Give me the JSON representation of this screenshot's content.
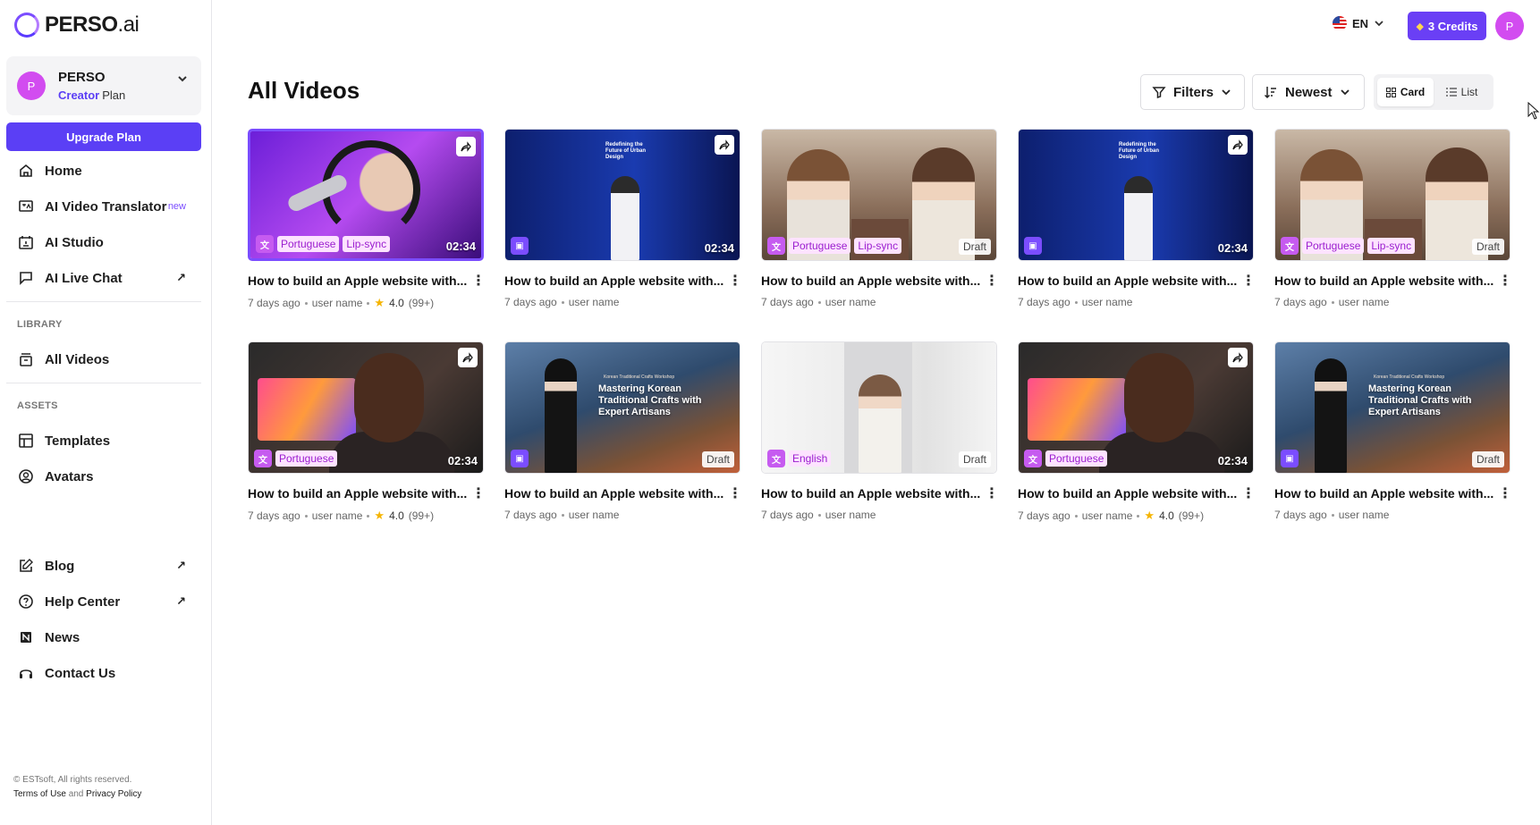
{
  "brand": {
    "name": "PERSO",
    "suffix": ".ai"
  },
  "workspace": {
    "avatar_letter": "P",
    "name": "PERSO",
    "plan_tier": "Creator",
    "plan_word": "Plan"
  },
  "sidebar": {
    "upgrade_label": "Upgrade Plan",
    "main_items": [
      {
        "label": "Home",
        "icon": "home-icon"
      },
      {
        "label": "AI Video Translator",
        "icon": "translate-icon",
        "badge": "new"
      },
      {
        "label": "AI Studio",
        "icon": "studio-icon"
      },
      {
        "label": "AI Live Chat",
        "icon": "chat-icon",
        "external": "↗"
      }
    ],
    "library_label": "LIBRARY",
    "library_items": [
      {
        "label": "All Videos",
        "icon": "archive-icon"
      }
    ],
    "assets_label": "ASSETS",
    "assets_items": [
      {
        "label": "Templates",
        "icon": "template-icon"
      },
      {
        "label": "Avatars",
        "icon": "avatar-icon"
      }
    ],
    "bottom_items": [
      {
        "label": "Blog",
        "icon": "edit-icon",
        "external": "↗"
      },
      {
        "label": "Help Center",
        "icon": "help-icon",
        "external": "↗"
      },
      {
        "label": "News",
        "icon": "news-icon"
      },
      {
        "label": "Contact Us",
        "icon": "headset-icon"
      }
    ],
    "footer": {
      "copyright": "© ESTsoft, All rights reserved.",
      "terms": "Terms of Use",
      "and": "and",
      "privacy": "Privacy Policy"
    }
  },
  "topbar": {
    "language": "EN",
    "credits": "3 Credits",
    "user_letter": "P"
  },
  "page": {
    "title": "All Videos",
    "filters_label": "Filters",
    "sort_label": "Newest",
    "view_card": "Card",
    "view_list": "List"
  },
  "videos": [
    {
      "art": "purple",
      "type": "translate",
      "tags": [
        "Portuguese",
        "Lip-sync"
      ],
      "duration": "02:34",
      "draft": "",
      "share": true,
      "selected": true,
      "title": "How to build an Apple website with...",
      "age": "7 days ago",
      "user": "user name",
      "rating": "4.0",
      "rating_count": "(99+)"
    },
    {
      "art": "presenter",
      "type": "studio",
      "tags": [],
      "duration": "02:34",
      "draft": "",
      "share": true,
      "selected": false,
      "title": "How to build an Apple website with...",
      "age": "7 days ago",
      "user": "user name",
      "rating": "",
      "rating_count": ""
    },
    {
      "art": "podcast",
      "type": "translate",
      "tags": [
        "Portuguese",
        "Lip-sync"
      ],
      "duration": "",
      "draft": "Draft",
      "share": false,
      "selected": false,
      "title": "How to build an Apple website with...",
      "age": "7 days ago",
      "user": "user name",
      "rating": "",
      "rating_count": ""
    },
    {
      "art": "presenter",
      "type": "studio",
      "tags": [],
      "duration": "02:34",
      "draft": "",
      "share": true,
      "selected": false,
      "title": "How to build an Apple website with...",
      "age": "7 days ago",
      "user": "user name",
      "rating": "",
      "rating_count": ""
    },
    {
      "art": "podcast",
      "type": "translate",
      "tags": [
        "Portuguese",
        "Lip-sync"
      ],
      "duration": "",
      "draft": "Draft",
      "share": false,
      "selected": false,
      "title": "How to build an Apple website with...",
      "age": "7 days ago",
      "user": "user name",
      "rating": "",
      "rating_count": ""
    },
    {
      "art": "man",
      "type": "translate",
      "tags": [
        "Portuguese"
      ],
      "duration": "02:34",
      "draft": "",
      "share": true,
      "selected": false,
      "title": "How to build an Apple website with...",
      "age": "7 days ago",
      "user": "user name",
      "rating": "4.0",
      "rating_count": "(99+)"
    },
    {
      "art": "korean",
      "type": "studio",
      "tags": [],
      "duration": "",
      "draft": "Draft",
      "share": false,
      "selected": false,
      "title": "How to build an Apple website with...",
      "age": "7 days ago",
      "user": "user name",
      "rating": "",
      "rating_count": ""
    },
    {
      "art": "white",
      "type": "translate",
      "tags": [
        "English"
      ],
      "duration": "",
      "draft": "Draft",
      "share": false,
      "selected": false,
      "title": "How to build an Apple website with...",
      "age": "7 days ago",
      "user": "user name",
      "rating": "",
      "rating_count": ""
    },
    {
      "art": "man",
      "type": "translate",
      "tags": [
        "Portuguese"
      ],
      "duration": "02:34",
      "draft": "",
      "share": true,
      "selected": false,
      "title": "How to build an Apple website with...",
      "age": "7 days ago",
      "user": "user name",
      "rating": "4.0",
      "rating_count": "(99+)"
    },
    {
      "art": "korean",
      "type": "studio",
      "tags": [],
      "duration": "",
      "draft": "Draft",
      "share": false,
      "selected": false,
      "title": "How to build an Apple website with...",
      "age": "7 days ago",
      "user": "user name",
      "rating": "",
      "rating_count": ""
    }
  ],
  "thumbnail_text": {
    "presenter_slide": "Redefining the Future of Urban Design",
    "korean_sub": "Korean Traditional Crafts Workshop",
    "korean_title": "Mastering Korean Traditional Crafts with Expert Artisans"
  },
  "colors": {
    "accent": "#5b3ff5",
    "avatar": "#d24cf0",
    "tag_bg": "#fde3ff",
    "tag_text": "#9b1ecf"
  }
}
